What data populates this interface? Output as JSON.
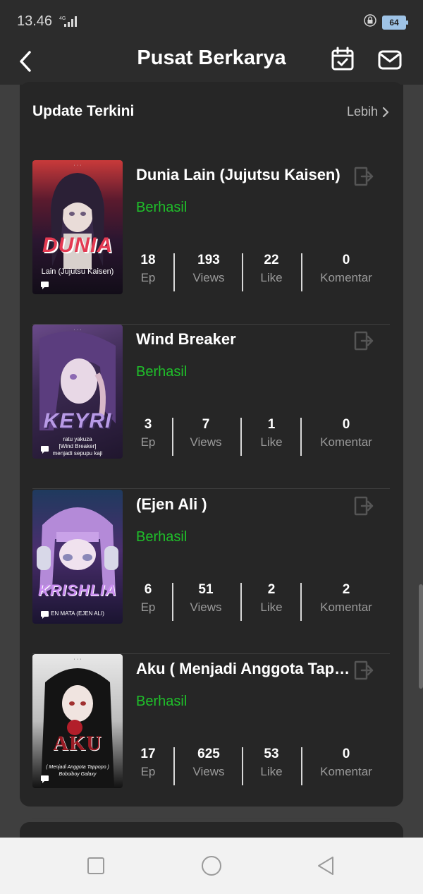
{
  "status_bar": {
    "time": "13.46",
    "network": "4G",
    "battery": "64"
  },
  "header": {
    "title": "Pusat Berkarya"
  },
  "section": {
    "title": "Update Terkini",
    "more_label": "Lebih"
  },
  "works": [
    {
      "title": "Dunia Lain (Jujutsu Kaisen)",
      "status": "Berhasil",
      "cover_title": "DUNIA",
      "cover_subtitle": "Lain (Jujutsu Kaisen)",
      "stats": {
        "ep": "18",
        "views": "193",
        "like": "22",
        "komentar": "0"
      }
    },
    {
      "title": "Wind Breaker",
      "status": "Berhasil",
      "cover_title": "KEYRI",
      "cover_subtitle": "ratu yakuza\n[Wind Breaker]\nmenjadi sepupu kaji",
      "stats": {
        "ep": "3",
        "views": "7",
        "like": "1",
        "komentar": "0"
      }
    },
    {
      "title": "(Ejen Ali )",
      "status": "Berhasil",
      "cover_title": "KRISHLIA",
      "cover_subtitle": "EN MATA (EJEN ALI)",
      "stats": {
        "ep": "6",
        "views": "51",
        "like": "2",
        "komentar": "2"
      }
    },
    {
      "title": "Aku ( Menjadi Anggota Tapopo )",
      "status": "Berhasil",
      "cover_title": "AKU",
      "cover_subtitle": "( Menjadi Anggota Tappopo )\nBoboiboy Galaxy",
      "stats": {
        "ep": "17",
        "views": "625",
        "like": "53",
        "komentar": "0"
      }
    }
  ],
  "stat_labels": {
    "ep": "Ep",
    "views": "Views",
    "like": "Like",
    "komentar": "Komentar"
  },
  "colors": {
    "status_green": "#1fbf2a",
    "card": "#262626",
    "background": "#3f3f3f"
  }
}
